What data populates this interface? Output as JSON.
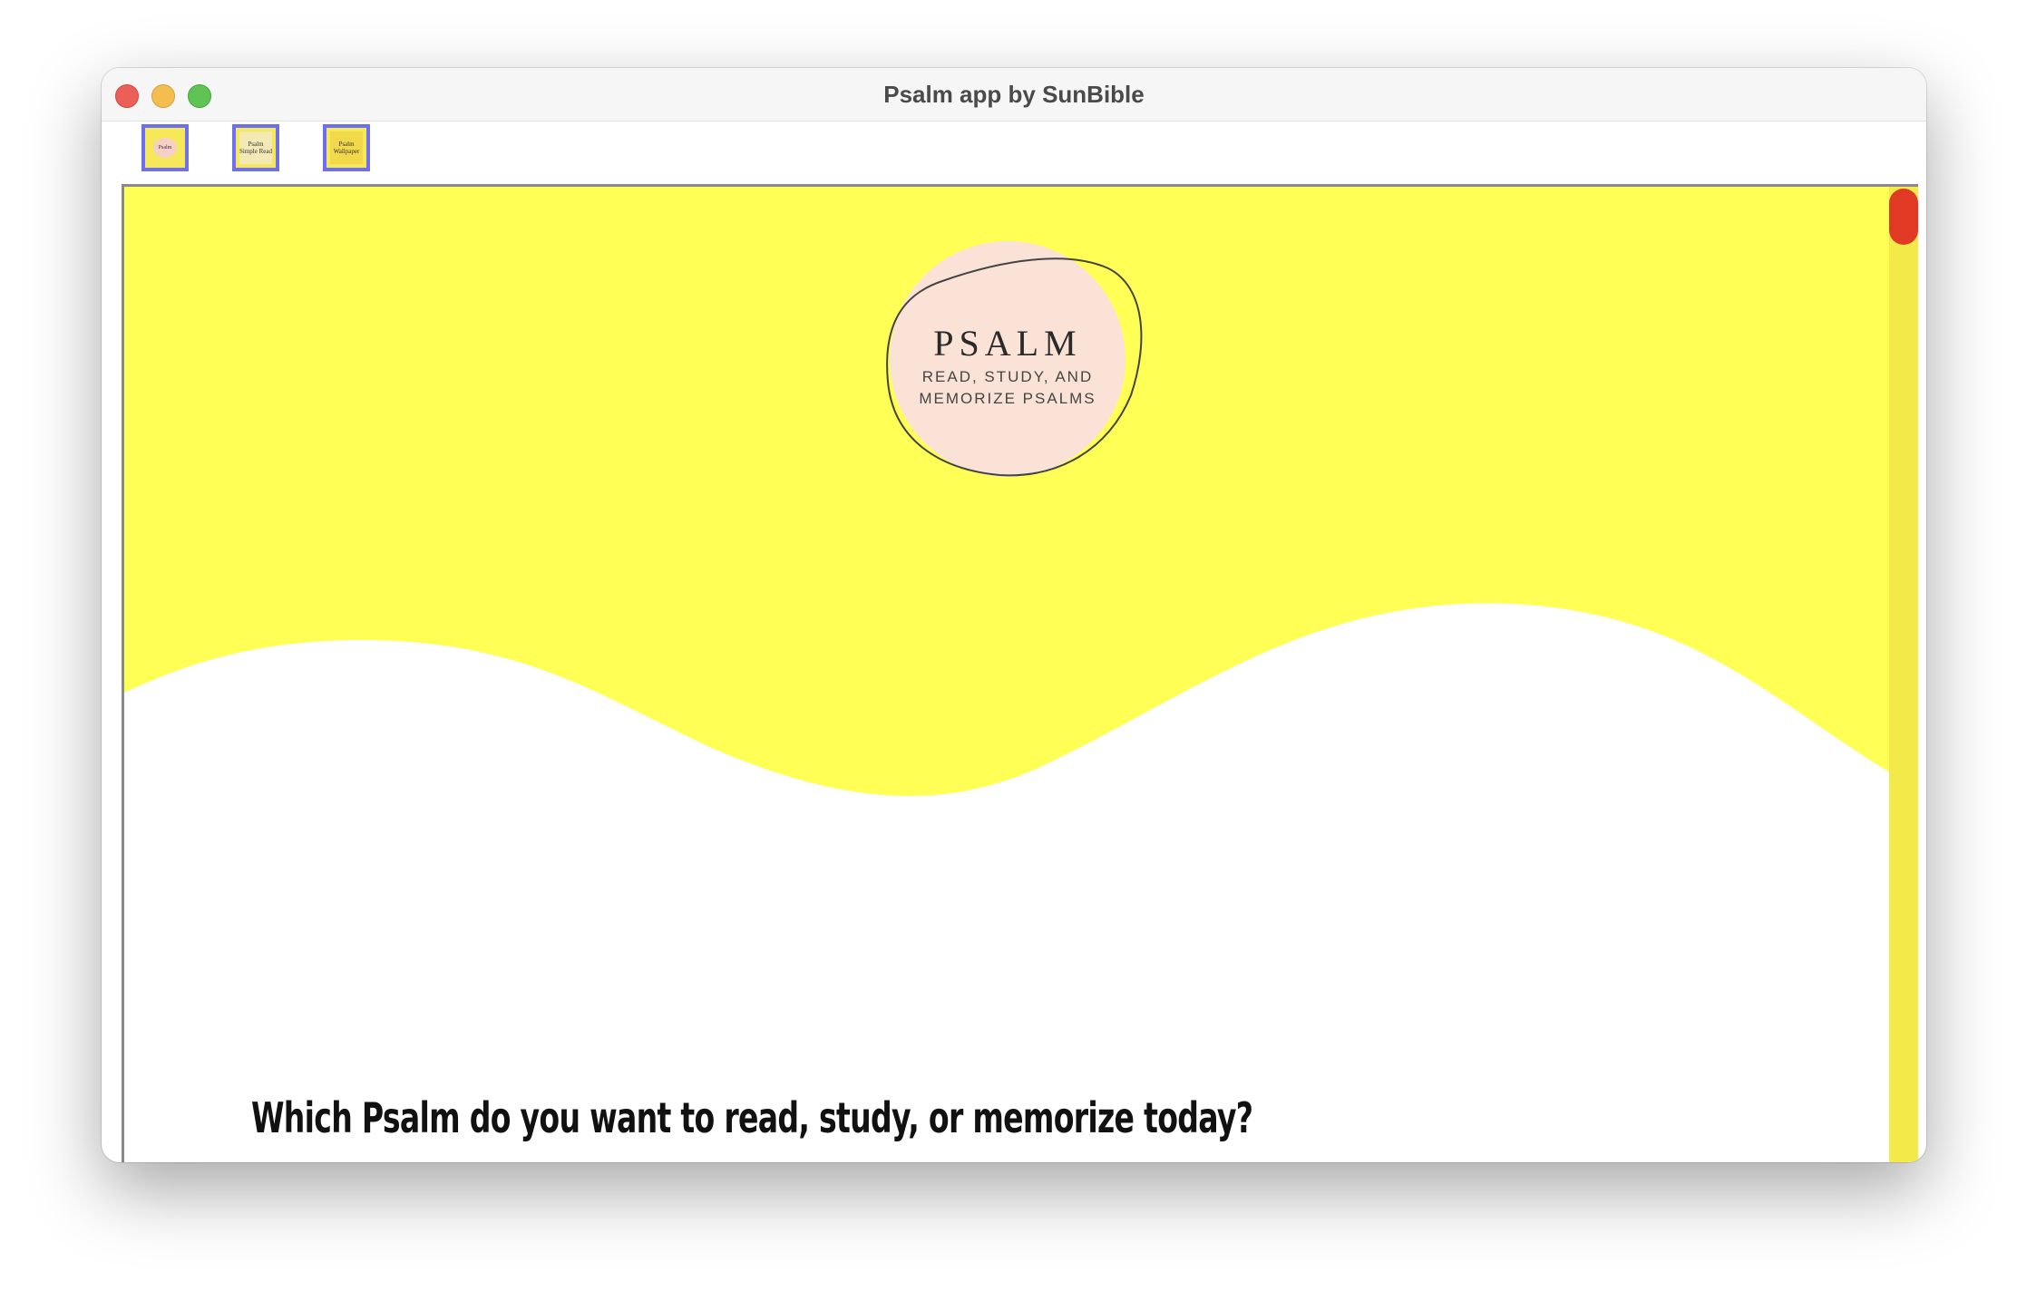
{
  "window": {
    "title": "Psalm app by SunBible"
  },
  "tabs": [
    {
      "label": "Psalm"
    },
    {
      "label": "Psalm Simple Read"
    },
    {
      "label": "Psalm Wallpaper"
    }
  ],
  "logo": {
    "title": "PSALM",
    "subtitle_line1": "READ, STUDY, AND",
    "subtitle_line2": "MEMORIZE PSALMS"
  },
  "main": {
    "question": "Which Psalm do you want to read, study, or memorize today?"
  },
  "colors": {
    "hero_yellow": "#ffff55",
    "logo_circle": "#fae3d6",
    "scrollbar_track": "#f3ea4a",
    "scrollbar_thumb": "#e03a24",
    "tab_border": "#6e6ef0"
  },
  "icons": [
    "close-icon",
    "minimize-icon",
    "maximize-icon"
  ]
}
